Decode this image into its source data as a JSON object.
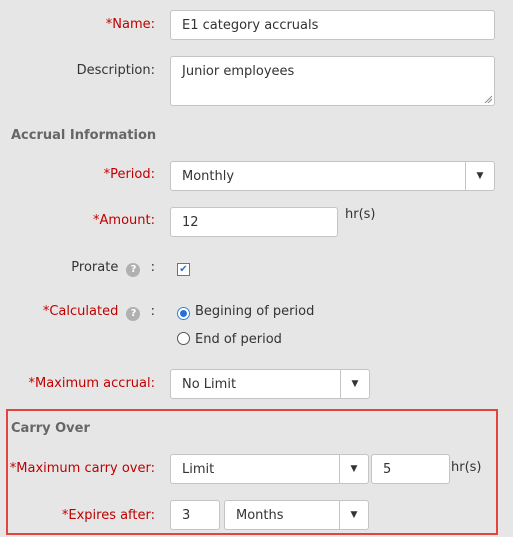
{
  "form": {
    "name": {
      "label": "*Name:",
      "value": "E1 category accruals"
    },
    "description": {
      "label": "Description:",
      "value": "Junior employees"
    },
    "accrual_section": {
      "title": "Accrual Information"
    },
    "period": {
      "label": "*Period:",
      "value": "Monthly"
    },
    "amount": {
      "label": "*Amount:",
      "value": "12",
      "unit": "hr(s)"
    },
    "prorate": {
      "label": "Prorate",
      "colon": ":",
      "checked": true
    },
    "calculated": {
      "label": "*Calculated",
      "colon": ":",
      "options": [
        "Begining of period",
        "End of period"
      ],
      "selected": "Begining of period"
    },
    "maximum_accrual": {
      "label": "*Maximum accrual:",
      "value": "No Limit"
    },
    "carry_over_section": {
      "title": "Carry Over"
    },
    "maximum_carry_over": {
      "label": "*Maximum carry over:",
      "value": "Limit",
      "amount": "5",
      "unit": "hr(s)"
    },
    "expires_after": {
      "label": "*Expires after:",
      "amount": "3",
      "unit_value": "Months"
    }
  },
  "icons": {
    "help": "?",
    "dropdown": "▼",
    "check": "✔"
  },
  "colors": {
    "required_label": "#c00000",
    "highlight_border": "#e3443e",
    "accent": "#2a6fd4"
  }
}
